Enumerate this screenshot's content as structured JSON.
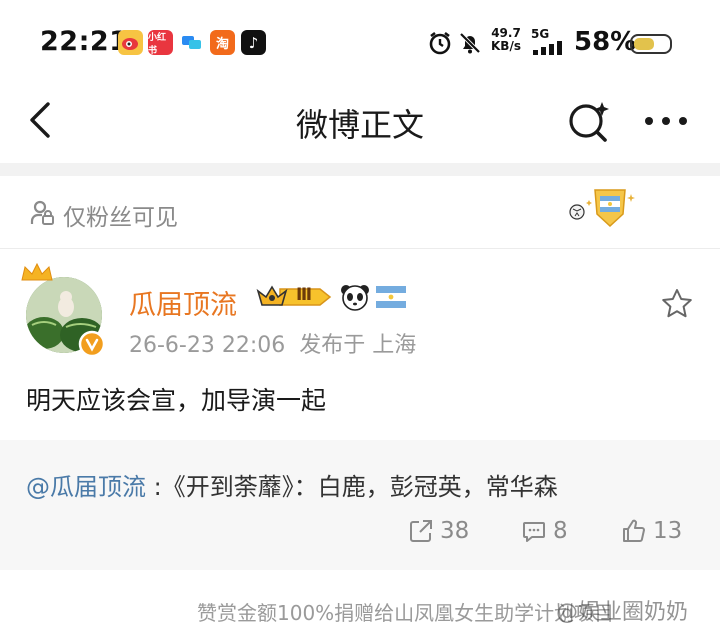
{
  "status_bar": {
    "time": "22:21",
    "apps": [
      {
        "name": "weibo-app-icon",
        "glyph": "◉",
        "color": "#f2b233"
      },
      {
        "name": "xiaohongshu-app-icon",
        "glyph": "小红书",
        "color": "#e9363f"
      },
      {
        "name": "chat-app-icon",
        "glyph": "▭",
        "color": "#2a8bf2"
      },
      {
        "name": "taobao-app-icon",
        "glyph": "淘",
        "color": "#f26a1b"
      },
      {
        "name": "tiktok-app-icon",
        "glyph": "♪",
        "color": "#111111"
      }
    ],
    "speed_value": "49.7",
    "speed_unit": "KB/s",
    "network": "5G",
    "battery_pct": "58%",
    "battery_level": 0.58
  },
  "nav": {
    "title": "微博正文"
  },
  "visibility": {
    "label": "仅粉丝可见"
  },
  "post": {
    "username": "瓜届顶流",
    "level_badge": "Ⅲ",
    "timestamp": "26-6-23 22:06",
    "location": "发布于 上海",
    "body": "明天应该会宣，加导演一起"
  },
  "repost": {
    "mention": "@瓜届顶流",
    "text": " :《开到荼蘼》：白鹿，彭冠英，常华森"
  },
  "stats": {
    "reposts": "38",
    "comments": "8",
    "likes": "13"
  },
  "footer": {
    "text": "赞赏金额100%捐赠给山凤凰女生助学计划项目",
    "watermark": "@娱业圈奶奶"
  },
  "colors": {
    "accent_orange": "#e87722",
    "mention_blue": "#4a7aa8",
    "muted": "#9a9a9a"
  }
}
